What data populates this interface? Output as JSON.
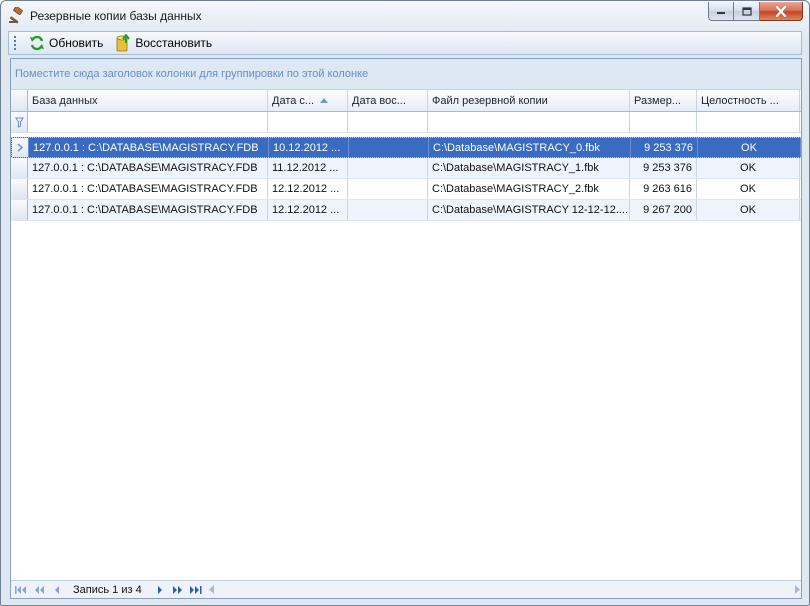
{
  "window": {
    "title": "Резервные копии базы данных",
    "app_icon": "gavel-icon"
  },
  "toolbar": {
    "refresh_label": "Обновить",
    "restore_label": "Восстановить"
  },
  "grid": {
    "group_panel_hint": "Поместите сюда заголовок колонки для группировки по этой колонке",
    "columns": [
      "База данных",
      "Дата с...",
      "Дата вос...",
      "Файл резервной копии",
      "Размер...",
      "Целостность ..."
    ],
    "sorted_column": "Дата с...",
    "rows": [
      {
        "db": "127.0.0.1 : C:\\DATABASE\\MAGISTRACY.FDB",
        "date": "10.12.2012 ...",
        "restore_date": "",
        "file": "C:\\Database\\MAGISTRACY_0.fbk",
        "size": "9 253 376",
        "integrity": "OK"
      },
      {
        "db": "127.0.0.1 : C:\\DATABASE\\MAGISTRACY.FDB",
        "date": "11.12.2012 ...",
        "restore_date": "",
        "file": "C:\\Database\\MAGISTRACY_1.fbk",
        "size": "9 253 376",
        "integrity": "OK"
      },
      {
        "db": "127.0.0.1 : C:\\DATABASE\\MAGISTRACY.FDB",
        "date": "12.12.2012 ...",
        "restore_date": "",
        "file": "C:\\Database\\MAGISTRACY_2.fbk",
        "size": "9 263 616",
        "integrity": "OK"
      },
      {
        "db": "127.0.0.1 : C:\\DATABASE\\MAGISTRACY.FDB",
        "date": "12.12.2012 ...",
        "restore_date": "",
        "file": "C:\\Database\\MAGISTRACY 12-12-12....",
        "size": "9 267 200",
        "integrity": "OK"
      }
    ],
    "selected_row": 0
  },
  "navigator": {
    "record_text": "Запись 1 из 4"
  },
  "colors": {
    "selection": "#3a6bc2",
    "group_hint": "#6a8dbd",
    "close_button": "#c44528"
  }
}
